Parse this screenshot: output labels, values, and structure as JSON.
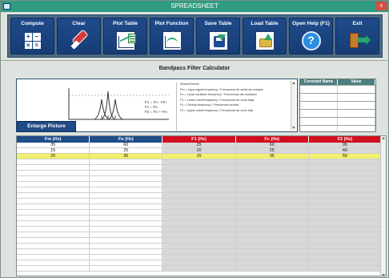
{
  "window": {
    "title": "SPREADSHEET",
    "close_label": "x"
  },
  "toolbar": {
    "buttons": [
      {
        "label": "Compute",
        "icon": "calculator-icon"
      },
      {
        "label": "Clear",
        "icon": "eraser-icon"
      },
      {
        "label": "Plot Table",
        "icon": "plot-table-icon"
      },
      {
        "label": "Plot Function",
        "icon": "plot-function-icon"
      },
      {
        "label": "Save Table",
        "icon": "save-icon"
      },
      {
        "label": "Load Table",
        "icon": "load-icon"
      },
      {
        "label": "Open Help (F1)",
        "icon": "help-icon"
      },
      {
        "label": "Exit",
        "icon": "exit-icon"
      }
    ],
    "fx_label": "f(x)",
    "help_symbol": "?"
  },
  "main": {
    "title": "Bandpass Filter Calculator",
    "enlarge_button": "Enlarge Picture",
    "picture_equations": [
      "F1 = Fo - Fm",
      "Fc = Fo",
      "F2 = Fo + Fm"
    ],
    "formula_notes": [
      "Where/Donde:",
      "Fm = Input signal frequency / Frecuencia de señal de entrada",
      "Fo = Local oscillator frequency / Frecuencia del oscilador",
      "F1 = Lower cutoff frequency / Frecuencia de corte baja",
      "Fc = Central frequency / Frecuencia central",
      "F2 = Upper cutoff frequency / Frecuencia de corte alta"
    ]
  },
  "constants": {
    "headers": [
      "Constant Name",
      "Value"
    ],
    "rows": [
      [
        "",
        ""
      ],
      [
        "",
        ""
      ],
      [
        "",
        ""
      ],
      [
        "",
        ""
      ],
      [
        "",
        ""
      ],
      [
        "",
        ""
      ]
    ]
  },
  "spreadsheet": {
    "headers": [
      {
        "label": "Fm (Hz)",
        "color": "#1f4d8a"
      },
      {
        "label": "Fo (Hz)",
        "color": "#1f4d8a"
      },
      {
        "label": "F1 (Hz)",
        "color": "#d10f1f"
      },
      {
        "label": "Fc (Hz)",
        "color": "#d10f1f"
      },
      {
        "label": "F2 (Hz)",
        "color": "#d10f1f"
      }
    ],
    "rows": [
      [
        "35",
        "60",
        "25",
        "60",
        "95"
      ],
      [
        "15",
        "25",
        "10",
        "25",
        "40"
      ],
      [
        "20",
        "35",
        "15",
        "35",
        "55"
      ]
    ],
    "highlighted_row_index": 2,
    "empty_row_count": 20
  }
}
